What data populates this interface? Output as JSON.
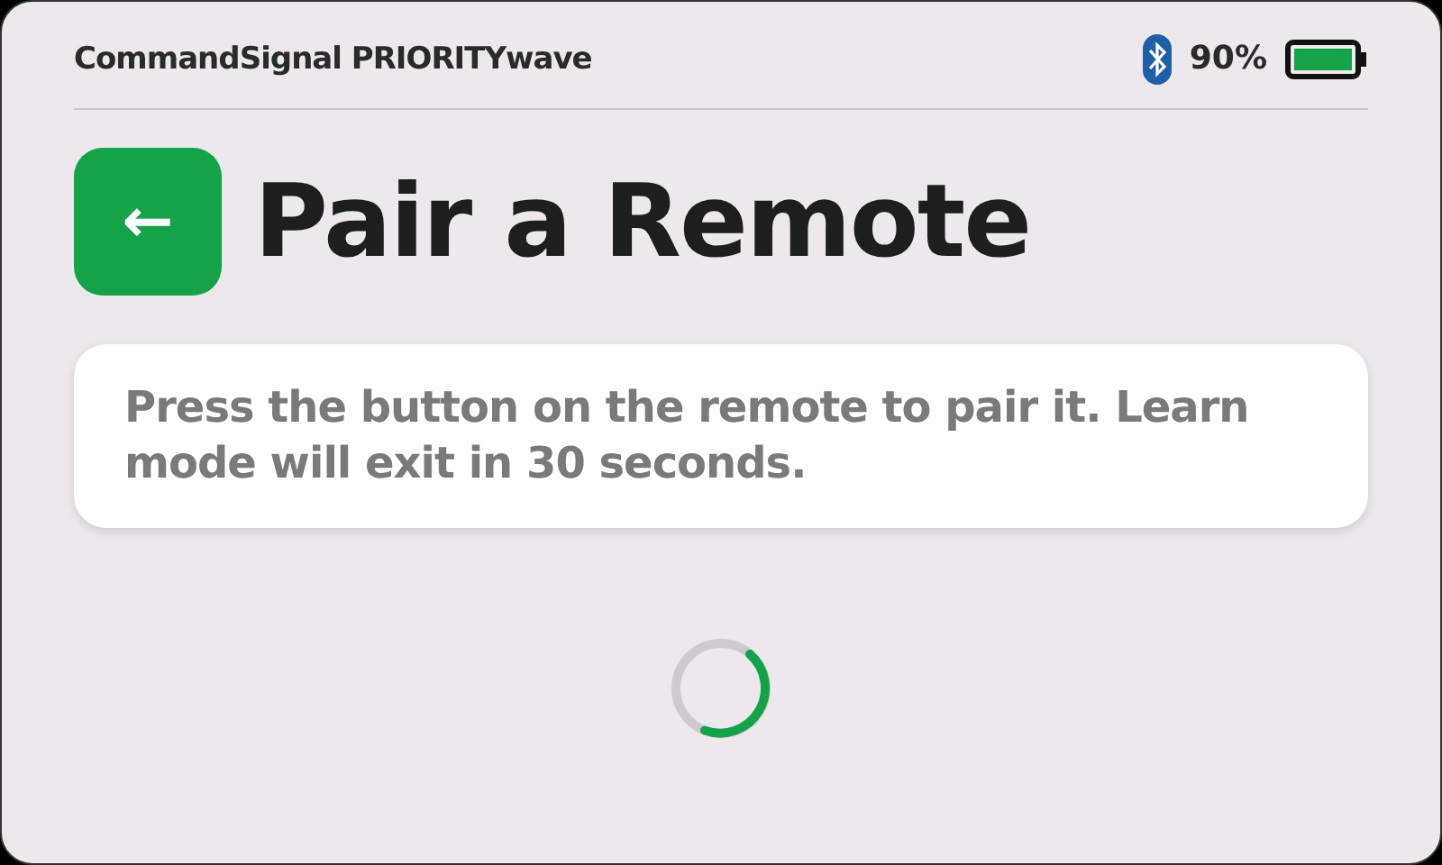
{
  "status_bar": {
    "title": "CommandSignal PRIORITYwave",
    "battery_text": "90%"
  },
  "header": {
    "back_button": "←",
    "title": "Pair a Remote"
  },
  "message": "Press the button on the remote to pair it. Learn mode will exit in 30 seconds."
}
